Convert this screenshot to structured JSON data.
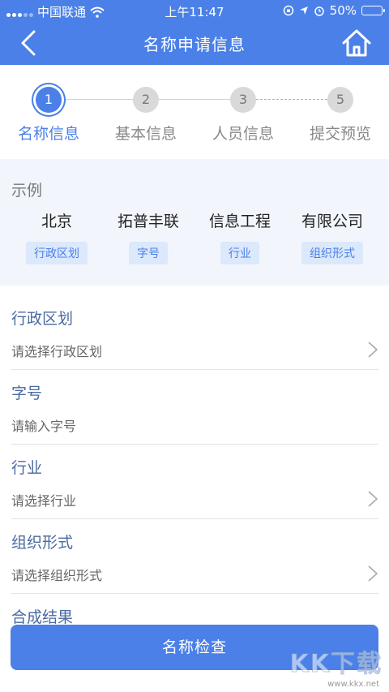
{
  "status_bar": {
    "carrier": "中国联通",
    "time": "上午11:47",
    "battery": "50%",
    "battery_level": 0.5
  },
  "nav": {
    "title": "名称申请信息",
    "back_icon": "chevron-left-icon",
    "home_icon": "home-icon"
  },
  "steps": [
    {
      "number": "1",
      "label": "名称信息",
      "active": true
    },
    {
      "number": "2",
      "label": "基本信息",
      "active": false
    },
    {
      "number": "3",
      "label": "人员信息",
      "active": false
    },
    {
      "number": "5",
      "label": "提交预览",
      "active": false
    }
  ],
  "example": {
    "title": "示例",
    "items": [
      {
        "word": "北京",
        "tag": "行政区划"
      },
      {
        "word": "拓普丰联",
        "tag": "字号"
      },
      {
        "word": "信息工程",
        "tag": "行业"
      },
      {
        "word": "有限公司",
        "tag": "组织形式"
      }
    ]
  },
  "form": {
    "fields": [
      {
        "label": "行政区划",
        "placeholder": "请选择行政区划",
        "has_chevron": true
      },
      {
        "label": "字号",
        "placeholder": "请输入字号",
        "has_chevron": false
      },
      {
        "label": "行业",
        "placeholder": "请选择行业",
        "has_chevron": true
      },
      {
        "label": "组织形式",
        "placeholder": "请选择组织形式",
        "has_chevron": true
      },
      {
        "label": "合成结果",
        "placeholder": "",
        "has_chevron": false
      }
    ]
  },
  "actions": {
    "check_label": "名称检查"
  },
  "watermark": {
    "text": "KK下载",
    "url": "www.kkx.net"
  },
  "colors": {
    "primary": "#4a80e8",
    "tag_bg": "#dce8fb",
    "example_bg": "#f2f6fc"
  }
}
